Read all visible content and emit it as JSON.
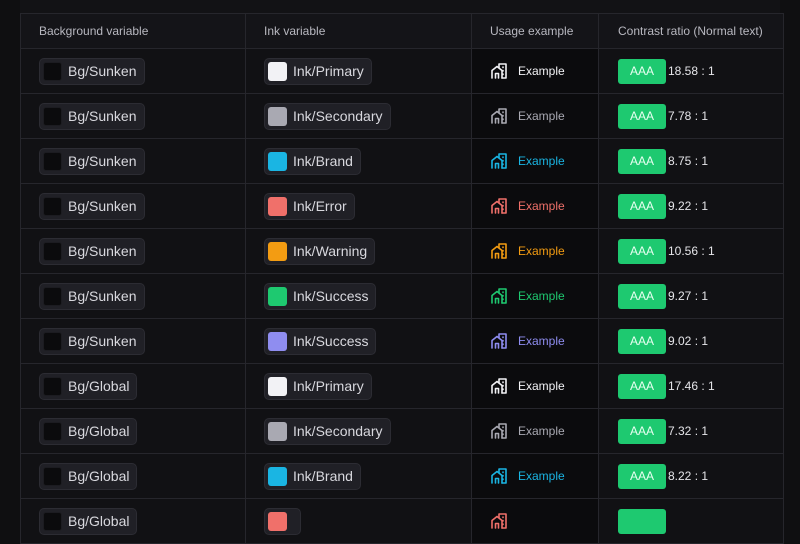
{
  "headers": {
    "background": "Background variable",
    "ink": "Ink variable",
    "usage": "Usage example",
    "contrast": "Contrast ratio (Normal text)"
  },
  "rows": [
    {
      "bg": "Bg/Sunken",
      "ink": "Ink/Primary",
      "ink_color": "#f2f2f5",
      "usage": "Example",
      "badge": "AAA",
      "ratio": "18.58 : 1"
    },
    {
      "bg": "Bg/Sunken",
      "ink": "Ink/Secondary",
      "ink_color": "#a9a9b2",
      "usage": "Example",
      "badge": "AAA",
      "ratio": "7.78 : 1"
    },
    {
      "bg": "Bg/Sunken",
      "ink": "Ink/Brand",
      "ink_color": "#1ab5e3",
      "usage": "Example",
      "badge": "AAA",
      "ratio": "8.75 : 1"
    },
    {
      "bg": "Bg/Sunken",
      "ink": "Ink/Error",
      "ink_color": "#f0706a",
      "usage": "Example",
      "badge": "AAA",
      "ratio": "9.22 : 1"
    },
    {
      "bg": "Bg/Sunken",
      "ink": "Ink/Warning",
      "ink_color": "#f39c12",
      "usage": "Example",
      "badge": "AAA",
      "ratio": "10.56 : 1"
    },
    {
      "bg": "Bg/Sunken",
      "ink": "Ink/Success",
      "ink_color": "#1ec970",
      "usage": "Example",
      "badge": "AAA",
      "ratio": "9.27 : 1"
    },
    {
      "bg": "Bg/Sunken",
      "ink": "Ink/Success",
      "ink_color": "#8f8df0",
      "usage": "Example",
      "badge": "AAA",
      "ratio": "9.02 : 1"
    },
    {
      "bg": "Bg/Global",
      "ink": "Ink/Primary",
      "ink_color": "#f2f2f5",
      "usage": "Example",
      "badge": "AAA",
      "ratio": "17.46 : 1"
    },
    {
      "bg": "Bg/Global",
      "ink": "Ink/Secondary",
      "ink_color": "#a9a9b2",
      "usage": "Example",
      "badge": "AAA",
      "ratio": "7.32 : 1"
    },
    {
      "bg": "Bg/Global",
      "ink": "Ink/Brand",
      "ink_color": "#1ab5e3",
      "usage": "Example",
      "badge": "AAA",
      "ratio": "8.22 : 1"
    },
    {
      "bg": "Bg/Global",
      "ink": "",
      "ink_color": "#f0706a",
      "usage": "",
      "badge": "",
      "ratio": ""
    }
  ],
  "colors": {
    "badge": "#1ec970",
    "bg_swatch": "#0b0b0d"
  },
  "icons": {
    "usage": "building-icon"
  }
}
